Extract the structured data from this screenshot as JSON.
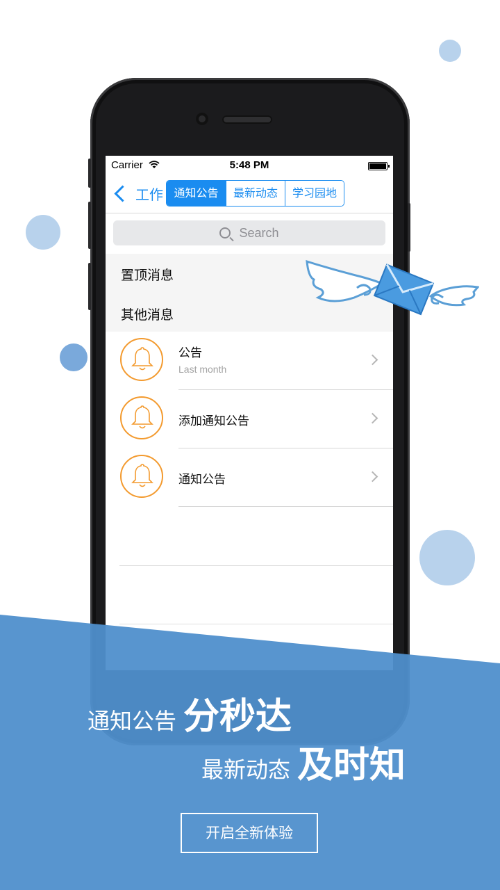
{
  "colors": {
    "accent": "#1a8cf0",
    "bell": "#f39a2e",
    "band": "#4f8fcc",
    "dot_light": "#b8d2ec",
    "dot_mid": "#7aa9db"
  },
  "status_bar": {
    "carrier": "Carrier",
    "time": "5:48 PM"
  },
  "navbar": {
    "back_label": "工作",
    "tabs": [
      {
        "label": "通知公告",
        "active": true
      },
      {
        "label": "最新动态",
        "active": false
      },
      {
        "label": "学习园地",
        "active": false
      }
    ]
  },
  "search": {
    "placeholder": "Search"
  },
  "sections": {
    "pinned": "置顶消息",
    "others": "其他消息"
  },
  "items": [
    {
      "title": "公告",
      "subtitle": "Last month",
      "icon": "bell-icon"
    },
    {
      "title": "添加通知公告",
      "icon": "bell-icon"
    },
    {
      "title": "通知公告",
      "icon": "bell-icon"
    }
  ],
  "promo": {
    "line1_small": "通知公告",
    "line1_big": "分秒达",
    "line2_small": "最新动态",
    "line2_big": "及时知",
    "cta": "开启全新体验"
  },
  "decor": {
    "winged_envelope": "winged-envelope-icon"
  }
}
